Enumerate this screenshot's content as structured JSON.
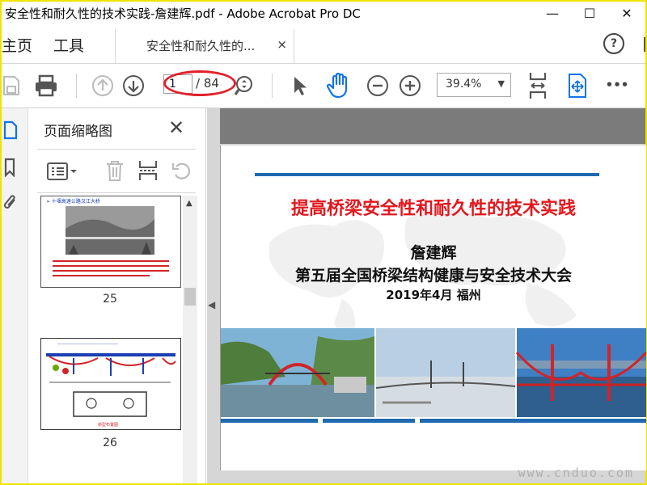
{
  "window": {
    "title": "安全性和耐久性的技术实践-詹建辉.pdf - Adobe Acrobat Pro DC",
    "minimize": "—",
    "maximize": "☐",
    "close": "✕"
  },
  "menu": {
    "home": "主页",
    "tools": "工具"
  },
  "tab": {
    "label": "安全性和耐久性的...",
    "close": "×"
  },
  "help": "?",
  "toolbar": {
    "page_current": "1",
    "page_total": "/ 84",
    "zoom": "39.4%",
    "more": "•••"
  },
  "panel": {
    "title": "页面缩略图",
    "close": "✕",
    "thumbnails": [
      {
        "number": "25",
        "heading": "➢ 十堰高速公路汉江大桥"
      },
      {
        "number": "26",
        "heading": "桥型布置图"
      }
    ]
  },
  "slide": {
    "title": "提高桥梁安全性和耐久性的技术实践",
    "author": "詹建辉",
    "conference": "第五届全国桥梁结构健康与安全技术大会",
    "date": "2019年4月  福州"
  },
  "watermark": {
    "bottom_right": "www.cnduo.com"
  },
  "colors": {
    "title_red": "#e3171e",
    "accent_blue": "#1f6ab0",
    "highlight_red": "#e2202a",
    "hand_icon_blue": "#1473e6"
  }
}
